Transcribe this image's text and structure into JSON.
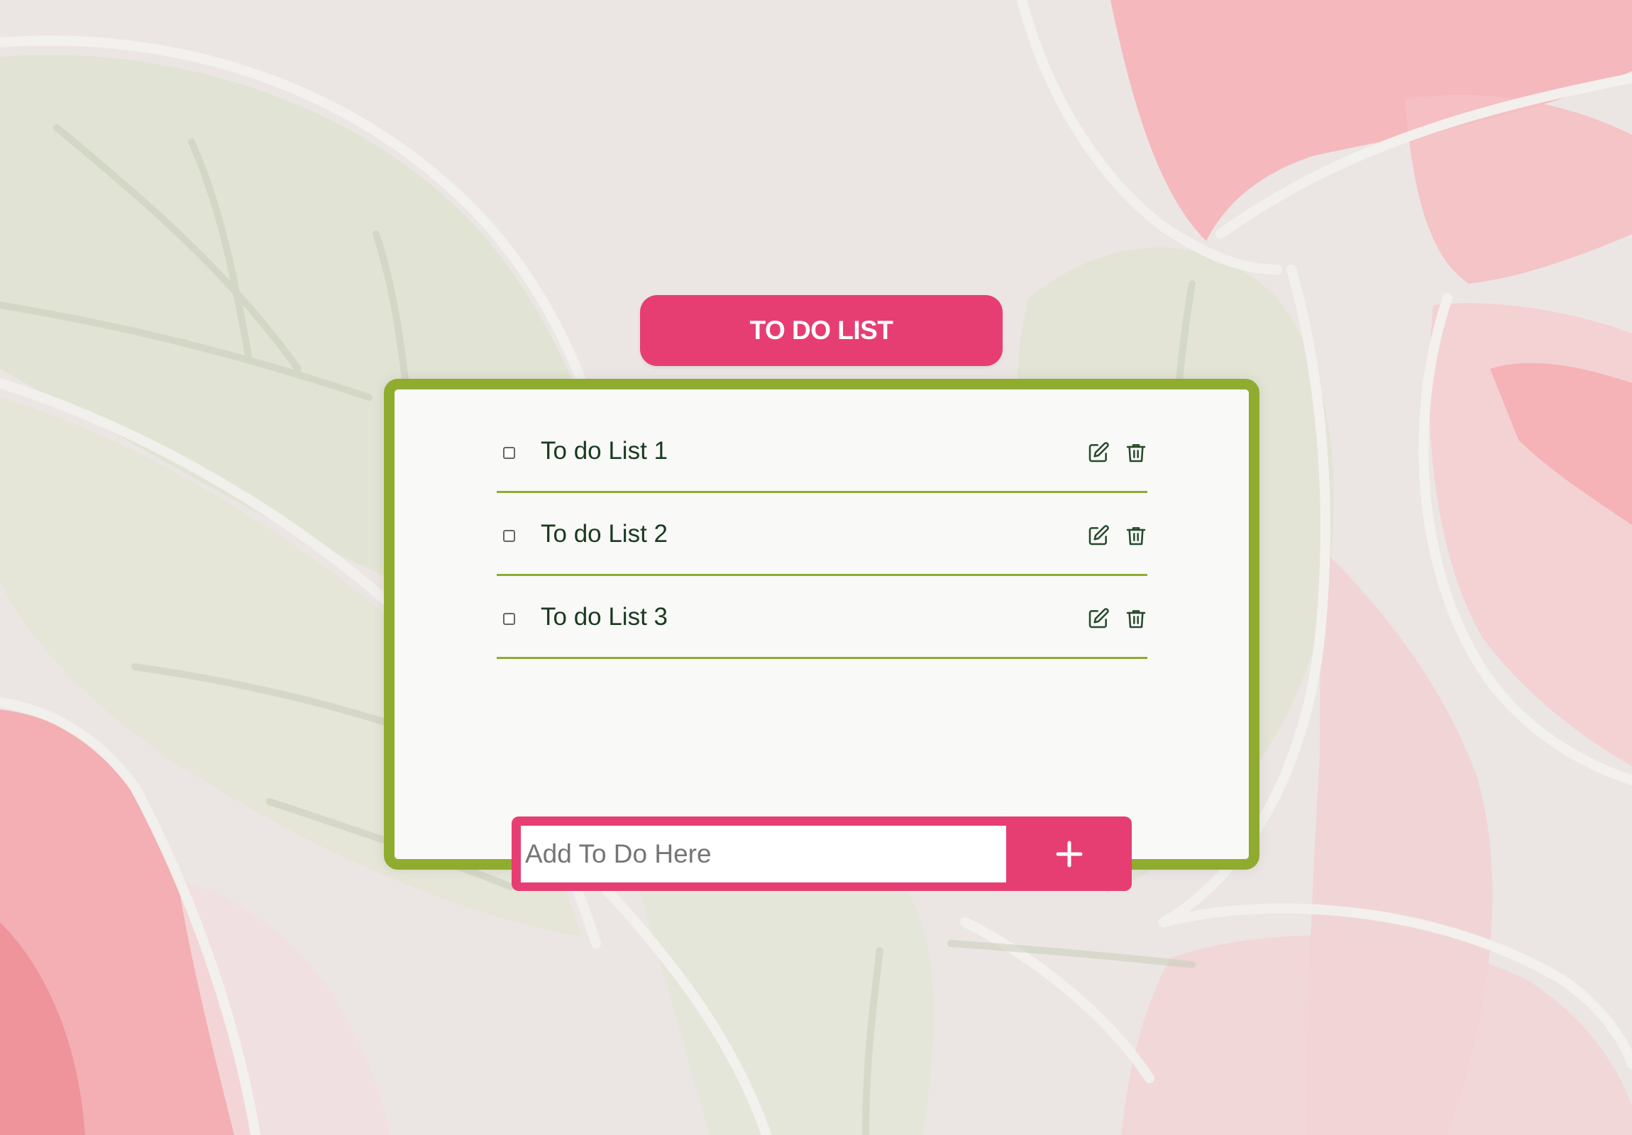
{
  "app": {
    "title": "TO DO LIST"
  },
  "colors": {
    "accent_pink": "#e63e73",
    "accent_green": "#8fac2f",
    "card_background": "#f9f9f8",
    "text_dark_green": "#1a3a1e"
  },
  "todos": [
    {
      "label": "To do List 1",
      "checked": false,
      "edit_icon": "edit-icon",
      "delete_icon": "trash-icon"
    },
    {
      "label": "To do List 2",
      "checked": false,
      "edit_icon": "edit-icon",
      "delete_icon": "trash-icon"
    },
    {
      "label": "To do List 3",
      "checked": false,
      "edit_icon": "edit-icon",
      "delete_icon": "trash-icon"
    }
  ],
  "add": {
    "placeholder": "Add To Do Here",
    "value": "",
    "button_icon": "plus-icon"
  }
}
